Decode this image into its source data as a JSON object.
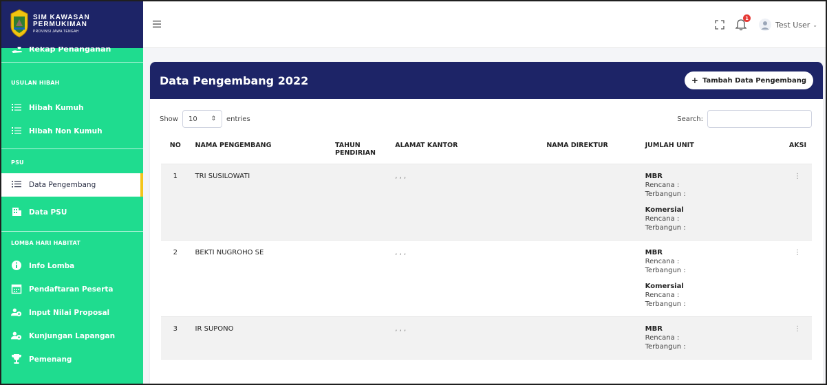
{
  "brand": {
    "line1": "SIM KAWASAN",
    "line2": "PERMUKIMAN",
    "line3": "PROVINSI JAWA TENGAH",
    "logo_icon": "central-java-emblem",
    "colors": {
      "sidebar": "#1fdc8f",
      "header": "#1d2467",
      "active_marker": "#f3c51b"
    }
  },
  "sidebar": {
    "partial_item": "Rekap Penanganan",
    "sections": [
      {
        "title": "USULAN HIBAH",
        "items": [
          {
            "label": "Hibah Kumuh",
            "icon": "list-icon"
          },
          {
            "label": "Hibah Non Kumuh",
            "icon": "list-icon"
          }
        ]
      },
      {
        "title": "PSU",
        "items": [
          {
            "label": "Data Pengembang",
            "icon": "list-icon",
            "active": true
          },
          {
            "label": "Data PSU",
            "icon": "building-icon"
          }
        ]
      },
      {
        "title": "LOMBA HARI HABITAT",
        "items": [
          {
            "label": "Info Lomba",
            "icon": "info-icon"
          },
          {
            "label": "Pendaftaran Peserta",
            "icon": "calendar-icon"
          },
          {
            "label": "Input Nilai Proposal",
            "icon": "users-icon"
          },
          {
            "label": "Kunjungan Lapangan",
            "icon": "users-icon"
          },
          {
            "label": "Pemenang",
            "icon": "trophy-icon"
          }
        ]
      }
    ]
  },
  "topbar": {
    "user_name": "Test User",
    "notification_count": "1"
  },
  "card": {
    "title": "Data Pengembang 2022",
    "add_button": "Tambah Data Pengembang",
    "show_label": "Show",
    "entries_value": "10",
    "entries_label": "entries",
    "search_label": "Search:"
  },
  "table": {
    "headers": [
      "NO",
      "NAMA PENGEMBANG",
      "TAHUN PENDIRIAN",
      "ALAMAT KANTOR",
      "NAMA DIREKTUR",
      "JUMLAH UNIT",
      "AKSI"
    ],
    "unit_labels": {
      "mbr": "MBR",
      "komersial": "Komersial",
      "rencana": "Rencana :",
      "terbangun": "Terbangun :"
    },
    "rows": [
      {
        "no": "1",
        "nama": "TRI SUSILOWATI",
        "tahun": "",
        "alamat": ", , ,",
        "direktur": ""
      },
      {
        "no": "2",
        "nama": "BEKTI NUGROHO SE",
        "tahun": "",
        "alamat": ", , ,",
        "direktur": ""
      },
      {
        "no": "3",
        "nama": "IR SUPONO",
        "tahun": "",
        "alamat": ", , ,",
        "direktur": ""
      }
    ]
  }
}
